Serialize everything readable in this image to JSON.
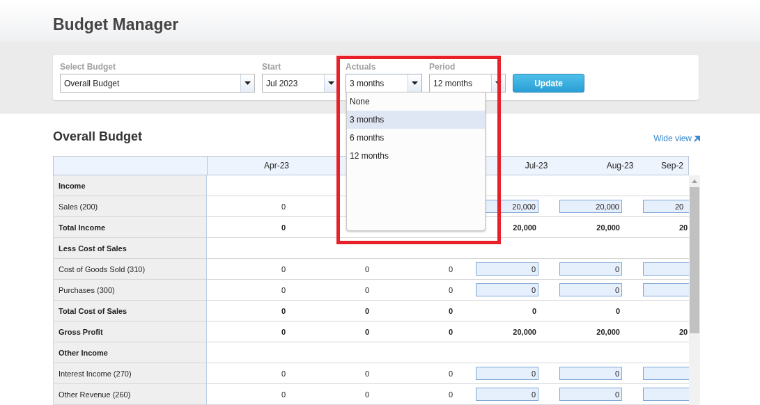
{
  "page_title": "Budget Manager",
  "filters": [
    {
      "label": "Select Budget",
      "value": "Overall Budget",
      "open": false
    },
    {
      "label": "Start",
      "value": "Jul 2023",
      "open": false
    },
    {
      "label": "Actuals",
      "value": "3 months",
      "open": true,
      "options": [
        {
          "label": "None",
          "selected": false
        },
        {
          "label": "3 months",
          "selected": true
        },
        {
          "label": "6 months",
          "selected": false
        },
        {
          "label": "12 months",
          "selected": false
        }
      ]
    },
    {
      "label": "Period",
      "value": "12 months",
      "open": false
    }
  ],
  "update_button": "Update",
  "section_title": "Overall Budget",
  "wide_view_link": "Wide view",
  "columns": {
    "column_1": "Apr-23",
    "column_4": "Jul-23",
    "column_5": "Aug-23",
    "column_6": "Sep-2"
  },
  "rows": [
    {
      "label": "Income",
      "kind": "section"
    },
    {
      "label": "Sales (200)",
      "kind": "account",
      "column_1": "0",
      "column_4": "20,000",
      "column_5": "20,000",
      "column_6": "20"
    },
    {
      "label": "Total Income",
      "kind": "total",
      "column_1": "0",
      "column_4": "20,000",
      "column_5": "20,000",
      "column_6": "20"
    },
    {
      "label": "Less Cost of Sales",
      "kind": "section"
    },
    {
      "label": "Cost of Goods Sold (310)",
      "kind": "account",
      "column_1": "0",
      "column_2": "0",
      "column_3": "0",
      "column_4": "0",
      "column_5": "0"
    },
    {
      "label": "Purchases (300)",
      "kind": "account",
      "column_1": "0",
      "column_2": "0",
      "column_3": "0",
      "column_4": "0",
      "column_5": "0"
    },
    {
      "label": "Total Cost of Sales",
      "kind": "total",
      "column_1": "0",
      "column_2": "0",
      "column_3": "0",
      "column_4": "0",
      "column_5": "0"
    },
    {
      "label": "Gross Profit",
      "kind": "total",
      "column_1": "0",
      "column_2": "0",
      "column_3": "0",
      "column_4": "20,000",
      "column_5": "20,000",
      "column_6": "20"
    },
    {
      "label": "Other Income",
      "kind": "section"
    },
    {
      "label": "Interest Income (270)",
      "kind": "account",
      "column_1": "0",
      "column_2": "0",
      "column_3": "0",
      "column_4": "0",
      "column_5": "0"
    },
    {
      "label": "Other Revenue (260)",
      "kind": "account",
      "column_1": "0",
      "column_2": "0",
      "column_3": "0",
      "column_4": "0",
      "column_5": "0"
    }
  ]
}
